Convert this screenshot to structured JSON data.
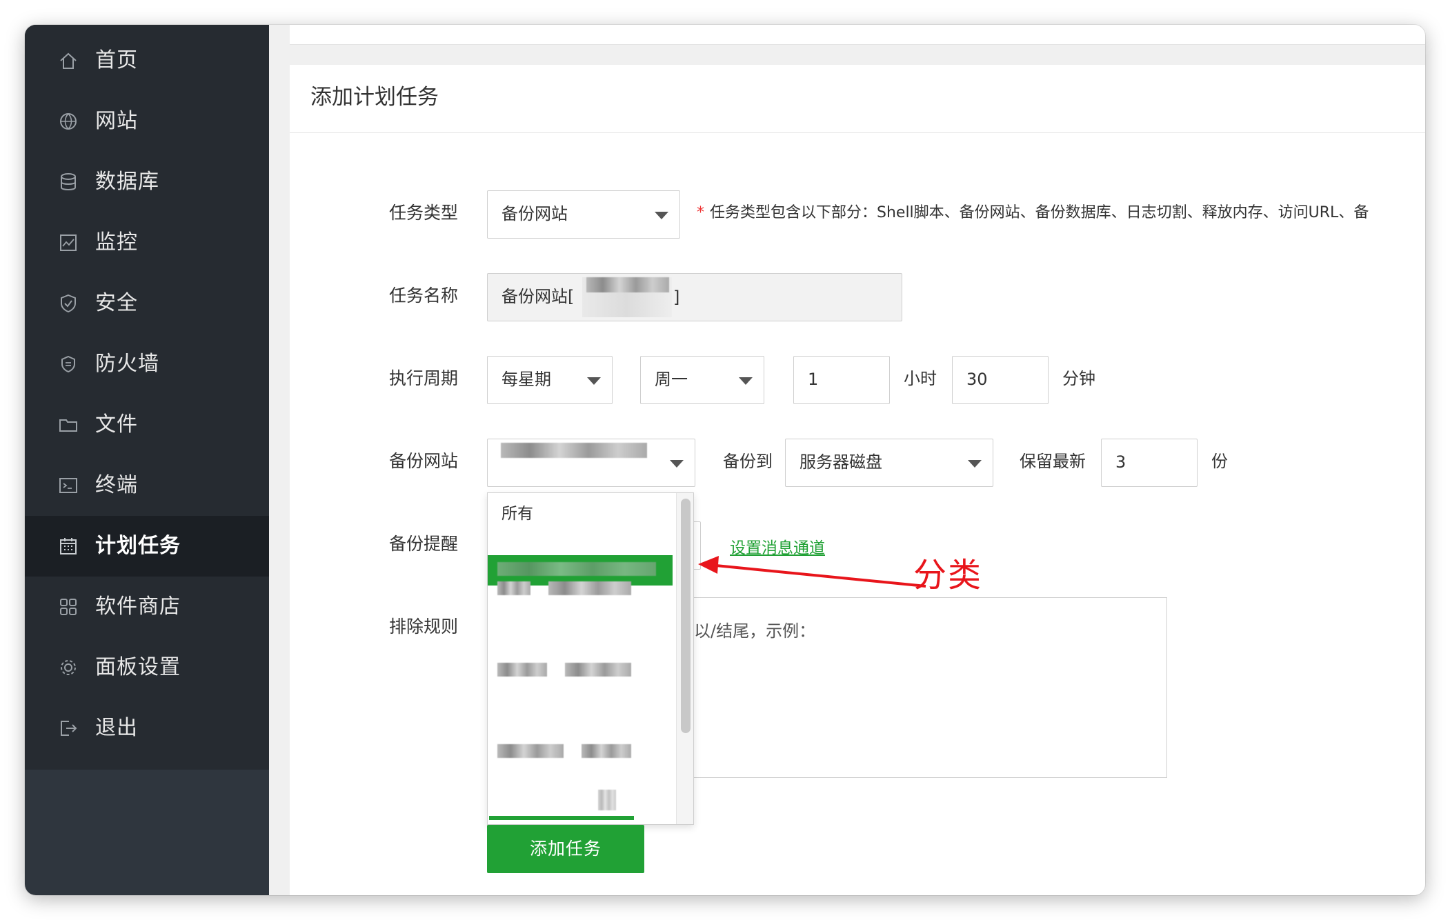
{
  "sidebar": {
    "items": [
      {
        "label": "首页",
        "icon": "home-icon"
      },
      {
        "label": "网站",
        "icon": "globe-icon"
      },
      {
        "label": "数据库",
        "icon": "database-icon"
      },
      {
        "label": "监控",
        "icon": "monitor-icon"
      },
      {
        "label": "安全",
        "icon": "shield-icon"
      },
      {
        "label": "防火墙",
        "icon": "firewall-icon"
      },
      {
        "label": "文件",
        "icon": "folder-icon"
      },
      {
        "label": "终端",
        "icon": "terminal-icon"
      },
      {
        "label": "计划任务",
        "icon": "calendar-icon"
      },
      {
        "label": "软件商店",
        "icon": "apps-icon"
      },
      {
        "label": "面板设置",
        "icon": "gear-icon"
      },
      {
        "label": "退出",
        "icon": "logout-icon"
      }
    ],
    "active_index": 8
  },
  "panel": {
    "title": "添加计划任务"
  },
  "form": {
    "task_type": {
      "label": "任务类型",
      "value": "备份网站",
      "hint": "任务类型包含以下部分：Shell脚本、备份网站、备份数据库、日志切割、释放内存、访问URL、备"
    },
    "task_name": {
      "label": "任务名称",
      "value_prefix": "备份网站[",
      "value_suffix": "]"
    },
    "period": {
      "label": "执行周期",
      "cycle": "每星期",
      "weekday": "周一",
      "hour": "1",
      "hour_unit": "小时",
      "minute": "30",
      "minute_unit": "分钟"
    },
    "backup_site": {
      "label": "备份网站",
      "backup_to_label": "备份到",
      "backup_to_value": "服务器磁盘",
      "keep_label": "保留最新",
      "keep_value": "3",
      "keep_unit": "份"
    },
    "reminder": {
      "label": "备份提醒",
      "link": "设置消息通道"
    },
    "exclude": {
      "label": "排除规则",
      "placeholder_visible": "以/结尾，示例："
    },
    "submit_label": "添加任务"
  },
  "dropdown": {
    "first_option": "所有"
  },
  "annotation": {
    "label": "分类",
    "color": "#e8151b"
  },
  "colors": {
    "sidebar_bg": "#262b31",
    "active_bg": "#1b1f24",
    "accent_green": "#21a135"
  }
}
